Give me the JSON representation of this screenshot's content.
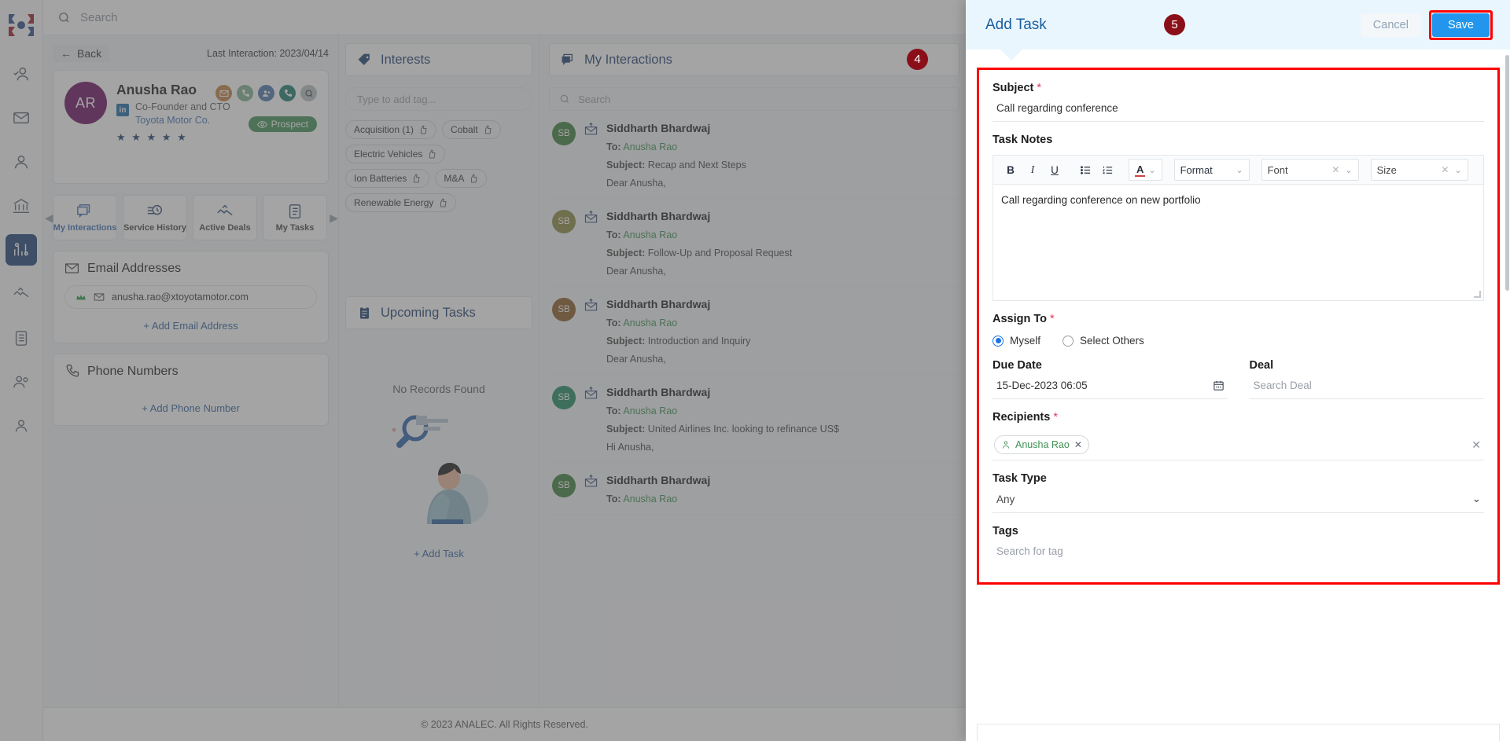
{
  "app": {
    "search_placeholder": "Search",
    "footer": "© 2023 ANALEC. All Rights Reserved."
  },
  "sidebar": {
    "items": [
      {
        "name": "logo",
        "icon": "analec-logo-icon"
      },
      {
        "name": "contacts-verified",
        "icon": "user-check-icon"
      },
      {
        "name": "mail",
        "icon": "envelope-icon"
      },
      {
        "name": "person",
        "icon": "user-icon"
      },
      {
        "name": "institution",
        "icon": "bank-icon"
      },
      {
        "name": "analytics",
        "icon": "chart-gear-icon",
        "active": true
      },
      {
        "name": "deals",
        "icon": "handshake-check-icon"
      },
      {
        "name": "tasks",
        "icon": "clipboard-icon"
      },
      {
        "name": "team",
        "icon": "user-group-icon"
      },
      {
        "name": "profile",
        "icon": "user-outline-icon"
      }
    ]
  },
  "contact": {
    "back_label": "Back",
    "last_interaction_label": "Last Interaction: 2023/04/14",
    "initials": "AR",
    "name": "Anusha Rao",
    "role": "Co-Founder and CTO",
    "company": "Toyota Motor Co.",
    "linkedin_badge": "in",
    "stars": "★ ★ ★ ★ ★",
    "status_badge": "Prospect",
    "action_icons": [
      {
        "name": "email-action-icon",
        "color": "#c18040"
      },
      {
        "name": "phone-action-icon",
        "color": "#7fb08c"
      },
      {
        "name": "meeting-action-icon",
        "color": "#4a76ab"
      },
      {
        "name": "call-note-action-icon",
        "color": "#1e7a6e"
      },
      {
        "name": "search-action-icon",
        "color": "#b9bec4"
      }
    ],
    "tabs": [
      {
        "label": "My Interactions",
        "icon": "chat-stack-icon",
        "active": true
      },
      {
        "label": "Service History",
        "icon": "history-clock-icon",
        "active": false
      },
      {
        "label": "Active Deals",
        "icon": "handshake-check-icon",
        "active": false
      },
      {
        "label": "My Tasks",
        "icon": "clipboard-icon",
        "active": false
      }
    ],
    "email_section": {
      "title": "Email Addresses",
      "icon": "envelope-icon",
      "entries": [
        {
          "value": "anusha.rao@xtoyotamotor.com",
          "primary_icon": "crown-icon",
          "type_icon": "envelope-icon"
        }
      ],
      "add_label": "+ Add Email Address"
    },
    "phone_section": {
      "title": "Phone Numbers",
      "icon": "phone-icon",
      "add_label": "+ Add Phone Number"
    }
  },
  "interests": {
    "title": "Interests",
    "icon": "tag-icon",
    "input_placeholder": "Type to add tag...",
    "tags": [
      {
        "label": "Acquisition (1)"
      },
      {
        "label": "Cobalt"
      },
      {
        "label": "Electric Vehicles"
      },
      {
        "label": "Ion Batteries"
      },
      {
        "label": "M&A"
      },
      {
        "label": "Renewable Energy"
      }
    ]
  },
  "upcoming_tasks": {
    "title": "Upcoming Tasks",
    "icon": "clipboard-check-icon",
    "empty_text": "No Records Found",
    "add_label": "+ Add Task"
  },
  "my_interactions": {
    "title": "My Interactions",
    "icon": "chat-stack-icon",
    "search_placeholder": "Search",
    "items": [
      {
        "initials": "SB",
        "avatar_color": "#3b7d3b",
        "name": "Siddharth Bhardwaj",
        "to_label": "To:",
        "to_value": "Anusha Rao",
        "subject_label": "Subject:",
        "subject_value": "Recap and Next Steps",
        "preview": "Dear Anusha,"
      },
      {
        "initials": "SB",
        "avatar_color": "#8a8a3f",
        "name": "Siddharth Bhardwaj",
        "to_label": "To:",
        "to_value": "Anusha Rao",
        "subject_label": "Subject:",
        "subject_value": "Follow-Up and Proposal Request",
        "preview": "Dear Anusha,"
      },
      {
        "initials": "SB",
        "avatar_color": "#8a5a25",
        "name": "Siddharth Bhardwaj",
        "to_label": "To:",
        "to_value": "Anusha Rao",
        "subject_label": "Subject:",
        "subject_value": "Introduction and Inquiry",
        "preview": "Dear Anusha,"
      },
      {
        "initials": "SB",
        "avatar_color": "#1e8a63",
        "name": "Siddharth Bhardwaj",
        "to_label": "To:",
        "to_value": "Anusha Rao",
        "subject_label": "Subject:",
        "subject_value": "United Airlines Inc. looking to refinance US$",
        "preview": "Hi Anusha,"
      },
      {
        "initials": "SB",
        "avatar_color": "#3b7d3b",
        "name": "Siddharth Bhardwaj",
        "to_label": "To:",
        "to_value": "Anusha Rao",
        "subject_label": "Subject:",
        "subject_value": "",
        "preview": ""
      }
    ]
  },
  "add_task_panel": {
    "title": "Add Task",
    "cancel_label": "Cancel",
    "save_label": "Save",
    "badge_form": "4",
    "badge_save": "5",
    "subject": {
      "label": "Subject",
      "required": "*",
      "value": "Call regarding conference"
    },
    "task_notes": {
      "label": "Task Notes",
      "body": "Call regarding conference on new portfolio",
      "toolbar": {
        "bold": "B",
        "italic": "I",
        "underline": "U",
        "bullet_list": "bullet-list-icon",
        "numbered_list": "numbered-list-icon",
        "font_color": "A",
        "format_label": "Format",
        "font_label": "Font",
        "size_label": "Size"
      }
    },
    "assign_to": {
      "label": "Assign To",
      "required": "*",
      "options": [
        {
          "label": "Myself",
          "selected": true
        },
        {
          "label": "Select Others",
          "selected": false
        }
      ]
    },
    "due_date": {
      "label": "Due Date",
      "value": "15-Dec-2023 06:05",
      "icon": "calendar-icon"
    },
    "deal": {
      "label": "Deal",
      "placeholder": "Search Deal"
    },
    "recipients": {
      "label": "Recipients",
      "required": "*",
      "chips": [
        {
          "label": "Anusha Rao",
          "icon": "user-icon"
        }
      ]
    },
    "task_type": {
      "label": "Task Type",
      "value": "Any"
    },
    "tags": {
      "label": "Tags",
      "placeholder": "Search for tag"
    },
    "colors": {
      "accent": "#2196ec",
      "highlight": "#ff0000",
      "badge": "#8a0f18",
      "header_bg": "#eaf6fd"
    }
  }
}
